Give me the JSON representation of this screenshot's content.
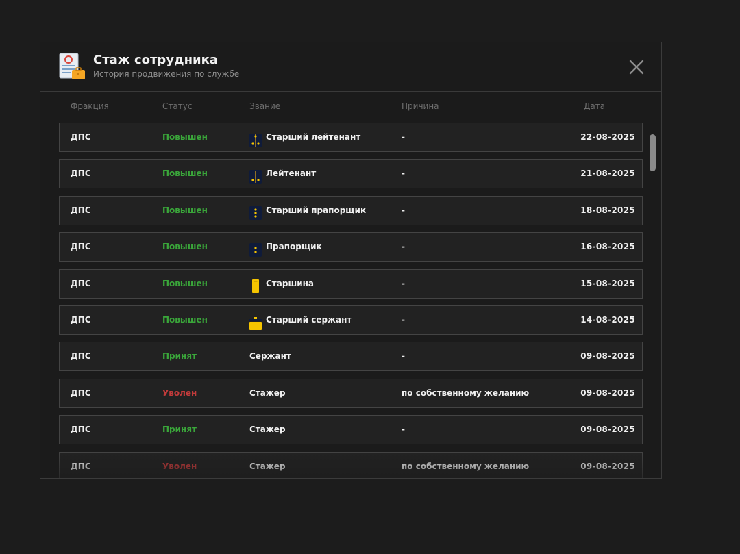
{
  "header": {
    "title": "Стаж сотрудника",
    "subtitle": "История продвижения по службе",
    "logo_icon": "document-briefcase-icon",
    "close_icon": "close-icon"
  },
  "columns": {
    "faction": "Фракция",
    "status": "Статус",
    "rank": "Звание",
    "reason": "Причина",
    "date": "Дата"
  },
  "colors": {
    "promoted": "#3aa63a",
    "fired": "#c23b3b",
    "badge_gold": "#f5c400",
    "badge_navy": "#0f1b3a"
  },
  "rows": [
    {
      "faction": "ДПС",
      "status": "Повышен",
      "status_type": "green",
      "rank": "Старший лейтенант",
      "badge": "star-three-icon",
      "reason": "-",
      "date": "22-08-2025"
    },
    {
      "faction": "ДПС",
      "status": "Повышен",
      "status_type": "green",
      "rank": "Лейтенант",
      "badge": "star-two-icon",
      "reason": "-",
      "date": "21-08-2025"
    },
    {
      "faction": "ДПС",
      "status": "Повышен",
      "status_type": "green",
      "rank": "Старший прапорщик",
      "badge": "dots-three-icon",
      "reason": "-",
      "date": "18-08-2025"
    },
    {
      "faction": "ДПС",
      "status": "Повышен",
      "status_type": "green",
      "rank": "Прапорщик",
      "badge": "dots-two-icon",
      "reason": "-",
      "date": "16-08-2025"
    },
    {
      "faction": "ДПС",
      "status": "Повышен",
      "status_type": "green",
      "rank": "Старшина",
      "badge": "gold-stripe-icon",
      "reason": "-",
      "date": "15-08-2025"
    },
    {
      "faction": "ДПС",
      "status": "Повышен",
      "status_type": "green",
      "rank": "Старший сержант",
      "badge": "gold-chevron-icon",
      "reason": "-",
      "date": "14-08-2025"
    },
    {
      "faction": "ДПС",
      "status": "Принят",
      "status_type": "green",
      "rank": "Сержант",
      "badge": "",
      "reason": "-",
      "date": "09-08-2025"
    },
    {
      "faction": "ДПС",
      "status": "Уволен",
      "status_type": "red",
      "rank": "Стажер",
      "badge": "",
      "reason": "по собственному желанию",
      "date": "09-08-2025"
    },
    {
      "faction": "ДПС",
      "status": "Принят",
      "status_type": "green",
      "rank": "Стажер",
      "badge": "",
      "reason": "-",
      "date": "09-08-2025"
    },
    {
      "faction": "ДПС",
      "status": "Уволен",
      "status_type": "red",
      "rank": "Стажер",
      "badge": "",
      "reason": "по собственному желанию",
      "date": "09-08-2025"
    }
  ]
}
